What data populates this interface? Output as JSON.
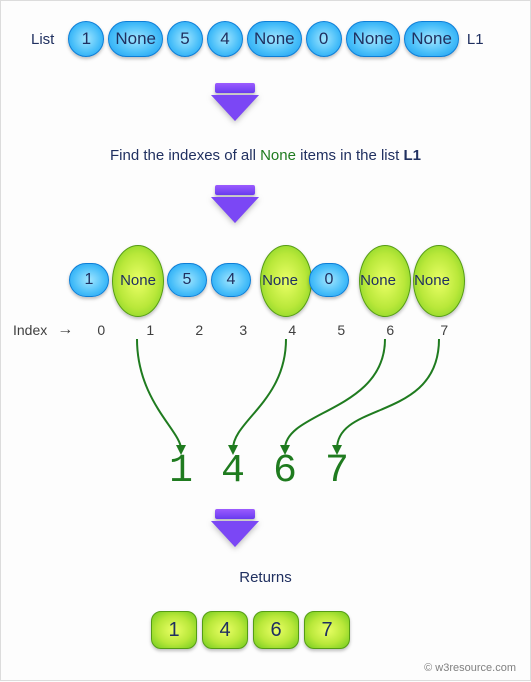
{
  "labels": {
    "list": "List",
    "l1": "L1",
    "index": "Index",
    "arrow": "→",
    "returns": "Returns",
    "copyright": "© w3resource.com"
  },
  "caption": {
    "pre": "Find the indexes of all ",
    "hl": "None",
    "post": " items in the list ",
    "tail": "L1"
  },
  "list": [
    "1",
    "None",
    "5",
    "4",
    "None",
    "0",
    "None",
    "None"
  ],
  "indexes": [
    "0",
    "1",
    "2",
    "3",
    "4",
    "5",
    "6",
    "7"
  ],
  "none_positions": [
    1,
    4,
    6,
    7
  ],
  "result": [
    "1",
    "4",
    "6",
    "7"
  ]
}
